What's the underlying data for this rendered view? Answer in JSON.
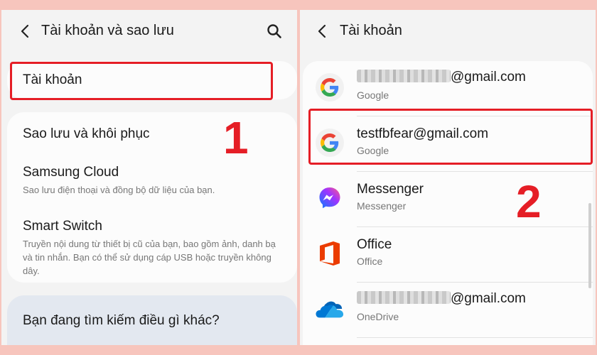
{
  "left": {
    "title": "Tài khoản và sao lưu",
    "accounts_label": "Tài khoản",
    "backup": {
      "title": "Sao lưu và khôi phục"
    },
    "samsung_cloud": {
      "title": "Samsung Cloud",
      "subtitle": "Sao lưu điện thoại và đồng bộ dữ liệu của bạn."
    },
    "smart_switch": {
      "title": "Smart Switch",
      "subtitle": "Truyền nội dung từ thiết bị cũ của bạn, bao gồm ảnh, danh bạ và tin nhắn. Bạn có thể sử dụng cáp USB hoặc truyền không dây."
    },
    "search_prompt": "Bạn đang tìm kiếm điều gì khác?",
    "step": "1"
  },
  "right": {
    "title": "Tài khoản",
    "step": "2",
    "items": [
      {
        "title_suffix": "@gmail.com",
        "subtitle": "Google",
        "icon": "google-icon"
      },
      {
        "title": "testfbfear@gmail.com",
        "subtitle": "Google",
        "icon": "google-icon"
      },
      {
        "title": "Messenger",
        "subtitle": "Messenger",
        "icon": "messenger-icon"
      },
      {
        "title": "Office",
        "subtitle": "Office",
        "icon": "office-icon"
      },
      {
        "title_suffix": "@gmail.com",
        "subtitle": "OneDrive",
        "icon": "onedrive-icon"
      }
    ]
  },
  "colors": {
    "highlight": "#e51e26",
    "background": "#f7c5bd"
  }
}
